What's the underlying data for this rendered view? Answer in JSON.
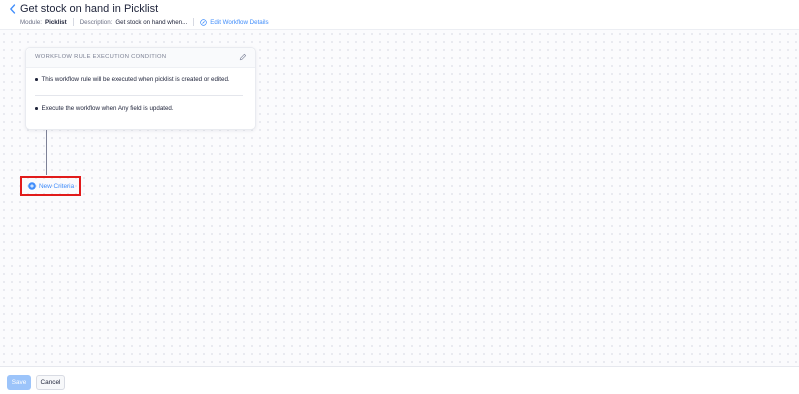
{
  "header": {
    "title": "Get stock on hand in Picklist",
    "module_label": "Module:",
    "module_value": "Picklist",
    "description_label": "Description:",
    "description_value": "Get stock on hand when...",
    "edit_link": "Edit Workflow Details"
  },
  "condition_card": {
    "title": "WORKFLOW RULE EXECUTION CONDITION",
    "rules": [
      "This workflow rule will be executed when picklist is created or edited.",
      "Execute the workflow when Any field is updated."
    ]
  },
  "actions": {
    "new_criteria": "New Criteria"
  },
  "footer": {
    "save": "Save",
    "cancel": "Cancel"
  },
  "colors": {
    "accent": "#408dfb",
    "highlight": "#e11b1b",
    "save_disabled": "#9cc4fa"
  },
  "icons": [
    "back-arrow-icon",
    "edit-icon",
    "pencil-icon",
    "plus-circle-icon"
  ]
}
